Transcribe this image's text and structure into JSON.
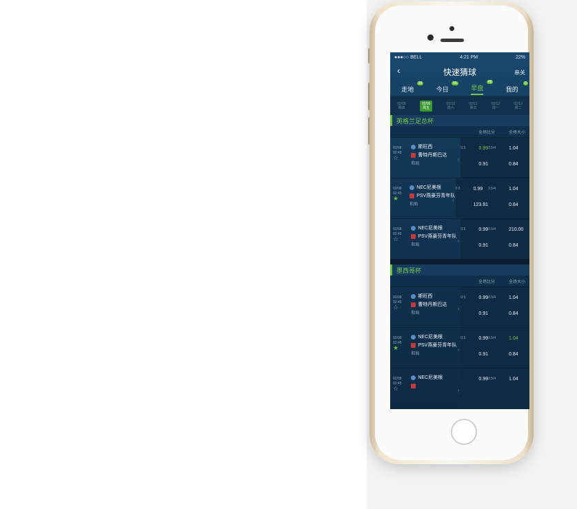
{
  "status": {
    "carrier": "●●●○○ BELL",
    "time": "4:21 PM",
    "battery": "22%"
  },
  "header": {
    "back": "‹",
    "title": "快速猜球",
    "mode": "串关"
  },
  "tabs": [
    {
      "label": "走地",
      "badge": "36"
    },
    {
      "label": "今日",
      "badge": "56"
    },
    {
      "label": "早盘",
      "badge": "48"
    },
    {
      "label": "我的",
      "badge": "0"
    }
  ],
  "dates": [
    {
      "d": "02/08",
      "w": "周四"
    },
    {
      "d": "02/09",
      "w": "周五"
    },
    {
      "d": "02/10",
      "w": "周六"
    },
    {
      "d": "02/11",
      "w": "周日"
    },
    {
      "d": "02/12",
      "w": "周一"
    },
    {
      "d": "02/13",
      "w": "周二"
    }
  ],
  "sub": {
    "a": "全场比分",
    "b": "全场大小"
  },
  "leagues": [
    {
      "name": "英格兰足总杯",
      "matches": [
        {
          "date": "02/08",
          "time": "02:45",
          "home": "斯旺西",
          "away": "曹特丹斯巴达",
          "draw": "和局",
          "h": "0.99",
          "hl": "0.5",
          "a": "0.91",
          "ou": "3.5/4",
          "o": "1.04",
          "u": "0.84",
          "fav": false
        },
        {
          "date": "02/08",
          "time": "02:45",
          "home": "NEC尼美根",
          "away": "PSV燕豪芬青年队",
          "draw": "和局",
          "h": "0.99",
          "hl": "0.5",
          "a": "123.91",
          "ou": "3.5/4",
          "o": "1.04",
          "u": "0.84",
          "fav": true
        },
        {
          "date": "02/08",
          "time": "02:45",
          "home": "NEC尼美根",
          "away": "PSV燕豪芬青年队",
          "draw": "和局",
          "h": "0.99",
          "hl": "0.5",
          "a": "0.91",
          "ou": "3.5/4",
          "o": "210.00",
          "u": "0.84",
          "fav": false
        }
      ]
    },
    {
      "name": "墨西哥杯",
      "matches": [
        {
          "date": "02/08",
          "time": "02:45",
          "home": "斯旺西",
          "away": "曹特丹斯巴达",
          "draw": "和局",
          "h": "0.99",
          "hl": "0.5",
          "a": "0.91",
          "ou": "3.5/4",
          "o": "1.04",
          "u": "0.84",
          "fav": false
        },
        {
          "date": "02/08",
          "time": "02:45",
          "home": "NEC尼美根",
          "away": "PSV燕豪芬青年队",
          "draw": "和局",
          "h": "0.99",
          "hl": "0.5",
          "a": "0.91",
          "ou": "3.5/4",
          "o": "1.04",
          "u": "0.84",
          "fav": true
        },
        {
          "date": "02/08",
          "time": "02:45",
          "home": "NEC尼美根",
          "away": "",
          "draw": "",
          "h": "0.99",
          "hl": "",
          "a": "",
          "ou": "3.5/4",
          "o": "1.04",
          "u": "",
          "fav": false
        }
      ]
    }
  ]
}
